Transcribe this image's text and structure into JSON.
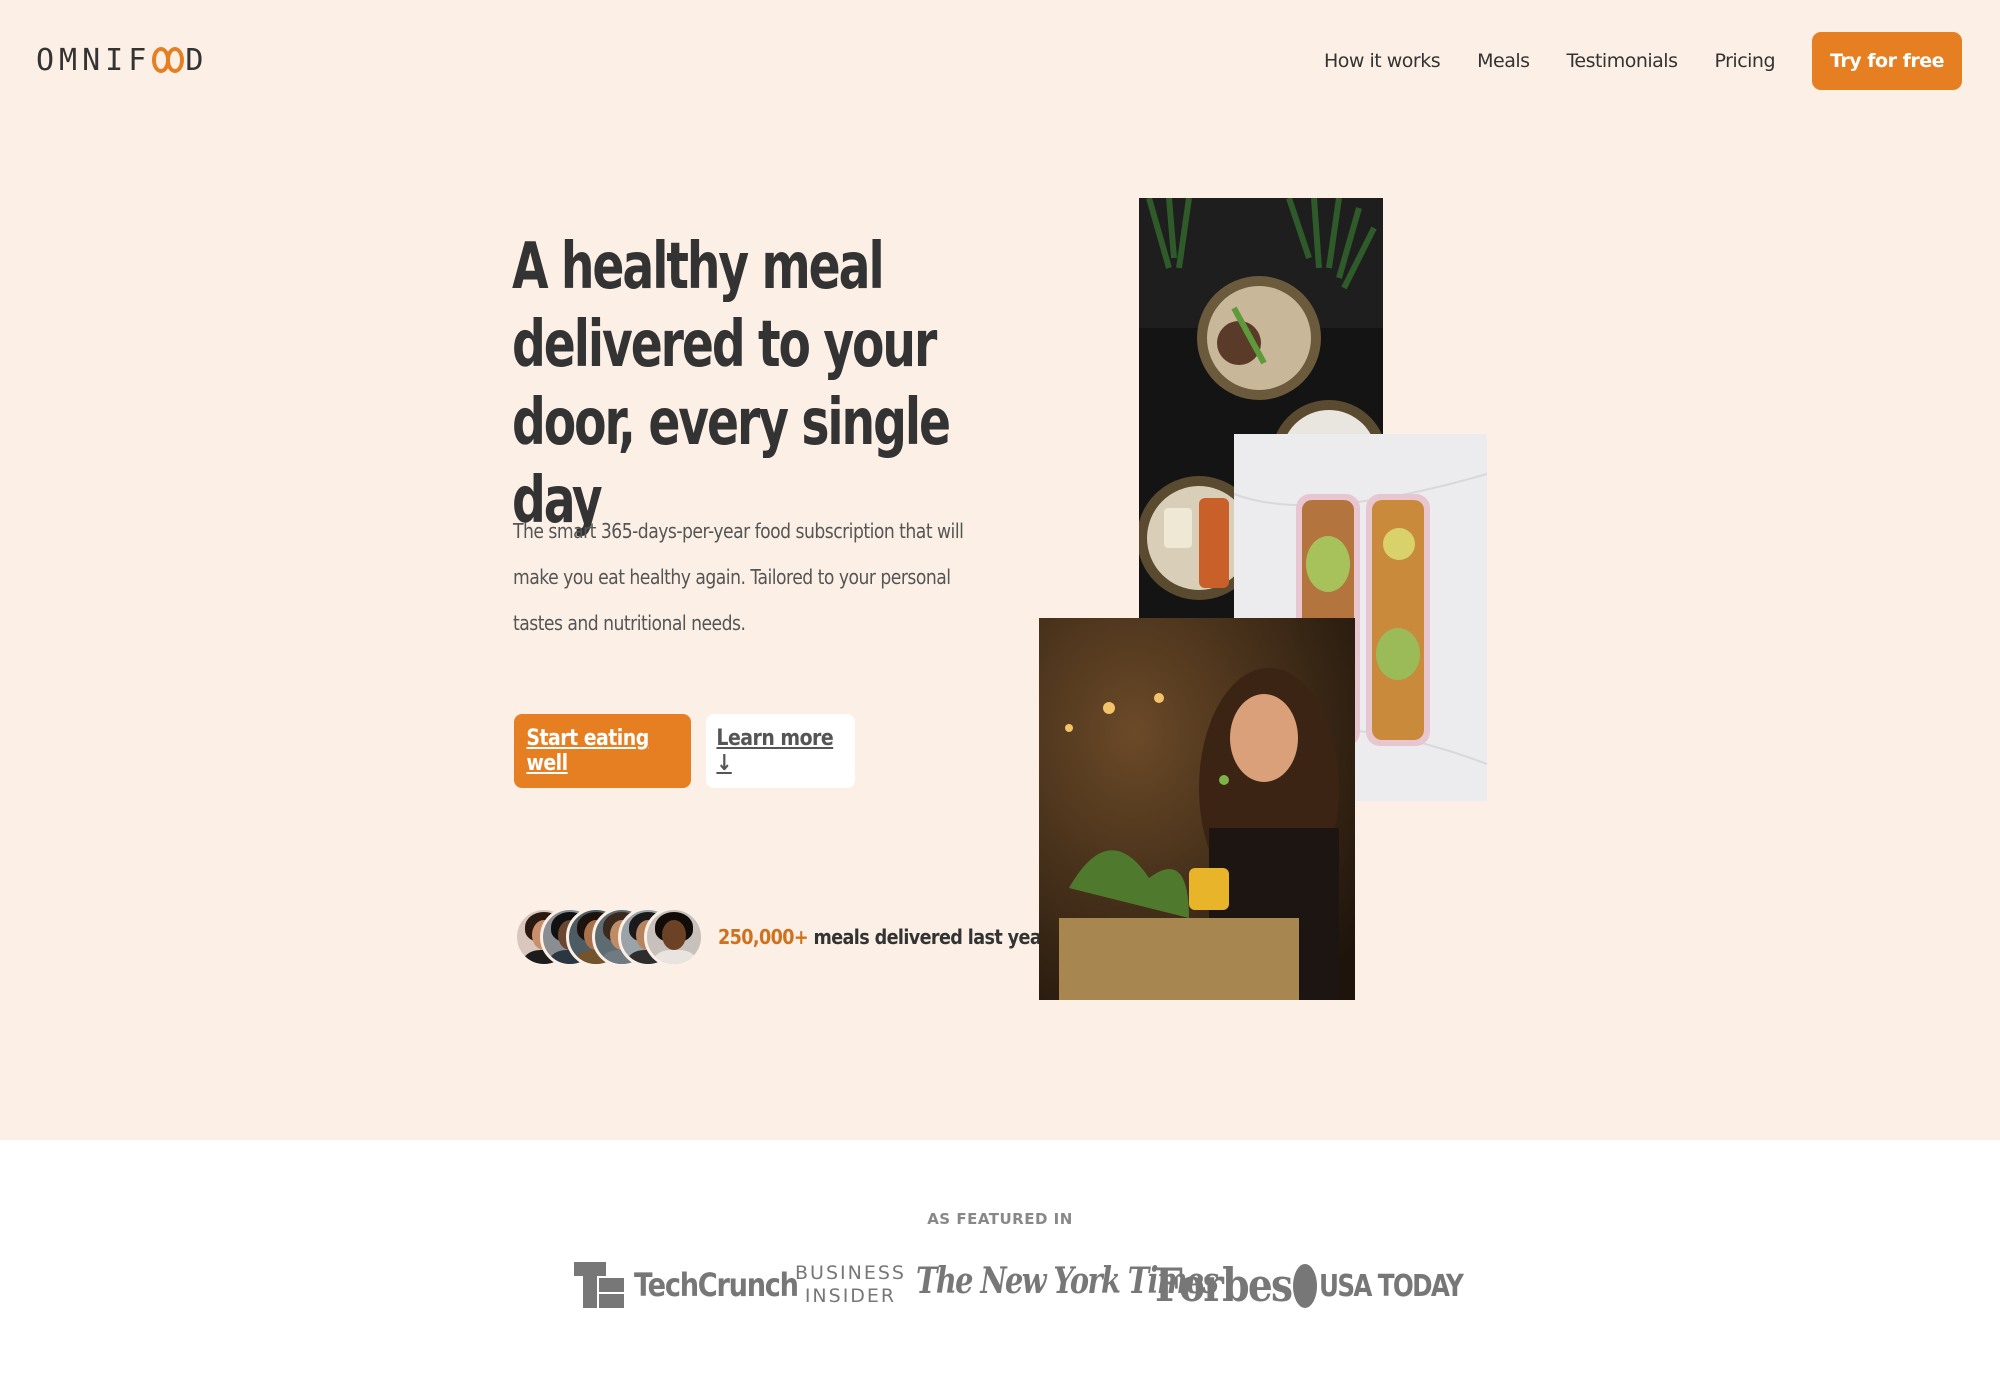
{
  "header": {
    "logo_left": "OMNIF",
    "logo_right": "D",
    "nav": [
      {
        "label": "How it works"
      },
      {
        "label": "Meals"
      },
      {
        "label": "Testimonials"
      },
      {
        "label": "Pricing"
      }
    ],
    "cta_label": "Try for free"
  },
  "hero": {
    "title": "A healthy meal delivered to your door, every single day",
    "description": "The smart 365-days-per-year food subscription that will make you eat healthy again. Tailored to your personal tastes and nutritional needs.",
    "primary_button": "Start eating well",
    "secondary_button": "Learn more ↓",
    "delivered_count": "250,000+",
    "delivered_text": " meals delivered last year!"
  },
  "featured": {
    "label": "AS FEATURED IN",
    "logos": [
      "TechCrunch",
      "BUSINESS",
      "INSIDER",
      "The New York Times",
      "Forbes",
      "USA TODAY"
    ]
  },
  "colors": {
    "accent": "#e67e22",
    "hero_background": "#fcf0e6",
    "text": "#333333"
  },
  "icons": [
    "infinity-logo-icon",
    "arrow-down-icon",
    "techcrunch-logo-icon",
    "usatoday-dot-icon"
  ]
}
